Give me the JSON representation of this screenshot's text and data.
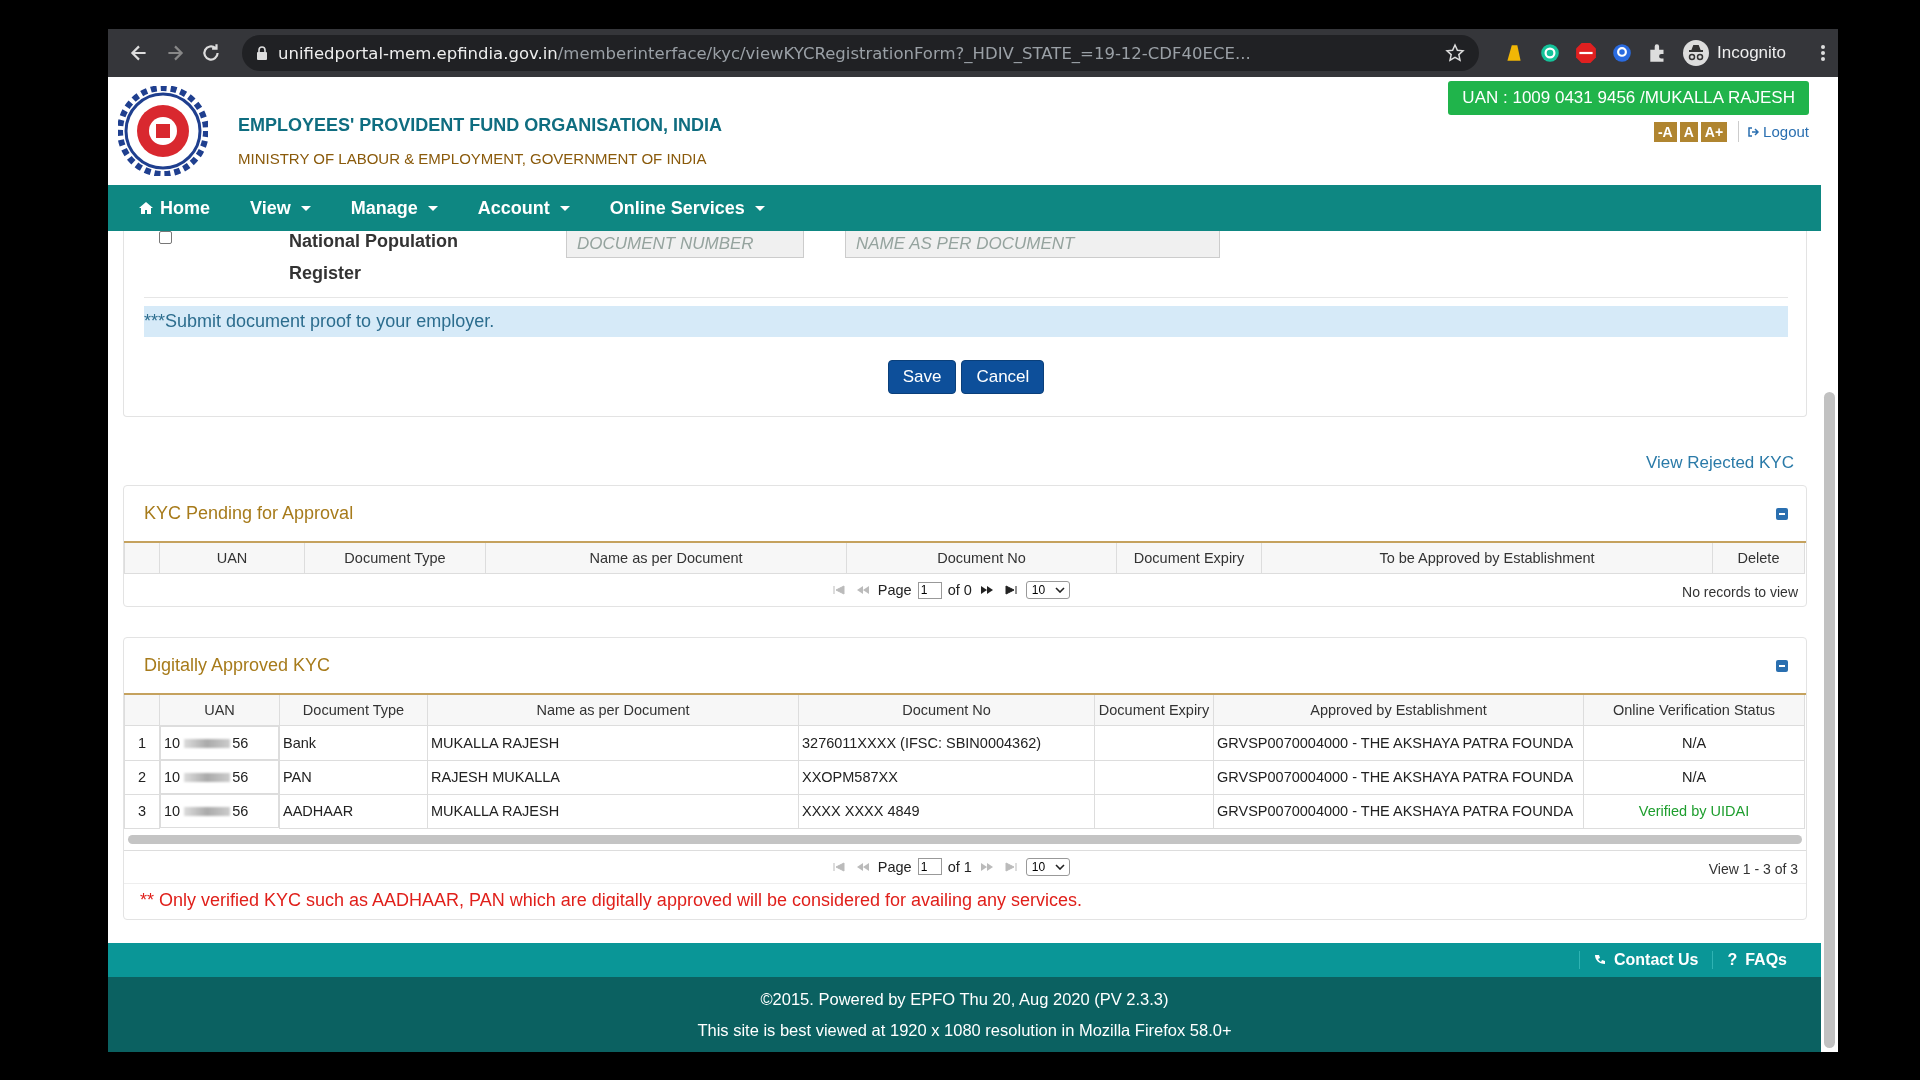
{
  "browser": {
    "url_host": "unifiedportal-mem.epfindia.gov.in",
    "url_path": "/memberinterface/kyc/viewKYCRegistrationForm?_HDIV_STATE_=19-12-CDF40ECE...",
    "profile_label": "Incognito"
  },
  "header": {
    "org_name": "EMPLOYEES' PROVIDENT FUND ORGANISATION, INDIA",
    "ministry": "MINISTRY OF LABOUR & EMPLOYMENT, GOVERNMENT OF INDIA",
    "uan_badge": "UAN : 1009 0431 9456 /MUKALLA RAJESH",
    "font_buttons": [
      "-A",
      "A",
      "A+"
    ],
    "logout": "Logout"
  },
  "nav": [
    {
      "label": "Home",
      "kind": "home"
    },
    {
      "label": "View",
      "kind": "menu"
    },
    {
      "label": "Manage",
      "kind": "menu"
    },
    {
      "label": "Account",
      "kind": "menu"
    },
    {
      "label": "Online Services",
      "kind": "menu"
    }
  ],
  "form": {
    "document": {
      "checked": false,
      "label_lines": [
        "National Population",
        "Register"
      ],
      "number_placeholder": "DOCUMENT NUMBER",
      "name_placeholder": "NAME AS PER DOCUMENT"
    },
    "notice": "***Submit document proof to your employer.",
    "buttons": [
      "Save",
      "Cancel"
    ]
  },
  "view_rejected": "View Rejected KYC",
  "pending": {
    "title": "KYC Pending for Approval",
    "columns": [
      "UAN",
      "Document Type",
      "Name as per Document",
      "Document No",
      "Document Expiry",
      "To be Approved by Establishment",
      "Delete"
    ],
    "pager": {
      "page_label": "Page",
      "page": "1",
      "of": "of 0",
      "size": "10",
      "prev_disabled": true,
      "next_disabled": false,
      "status": "No records to view"
    }
  },
  "approved": {
    "title": "Digitally Approved KYC",
    "columns": [
      "UAN",
      "Document Type",
      "Name as per Document",
      "Document No",
      "Document Expiry",
      "Approved by Establishment",
      "Online Verification Status"
    ],
    "rows": [
      {
        "index": "1",
        "uan_start": "10",
        "uan_end": "56",
        "doc_type": "Bank",
        "name": "MUKALLA RAJESH",
        "doc_no": "3276011XXXX (IFSC: SBIN0004362)",
        "establishment": "GRVSP0070004000 - THE AKSHAYA PATRA FOUNDA",
        "status": "N/A",
        "verified": false
      },
      {
        "index": "2",
        "uan_start": "10",
        "uan_end": "56",
        "doc_type": "PAN",
        "name": "RAJESH MUKALLA",
        "doc_no": "XXOPM587XX",
        "establishment": "GRVSP0070004000 - THE AKSHAYA PATRA FOUNDA",
        "status": "N/A",
        "verified": false
      },
      {
        "index": "3",
        "uan_start": "10",
        "uan_end": "56",
        "doc_type": "AADHAAR",
        "name": "MUKALLA RAJESH",
        "doc_no": "XXXX XXXX 4849",
        "establishment": "GRVSP0070004000 - THE AKSHAYA PATRA FOUNDA",
        "status": "Verified by UIDAI",
        "verified": true
      }
    ],
    "pager": {
      "page_label": "Page",
      "page": "1",
      "of": "of 1",
      "size": "10",
      "prev_disabled": true,
      "next_disabled": true,
      "status": "View 1 - 3 of 3"
    },
    "notice": "** Only verified KYC such as AADHAAR, PAN which are digitally approved will be considered for availing any services."
  },
  "footer": {
    "links": [
      {
        "label": "Contact Us",
        "kind": "phone"
      },
      {
        "label": "FAQs",
        "kind": "help",
        "glyph": "?"
      }
    ],
    "copyright": "©2015. Powered by EPFO Thu 20, Aug 2020 (PV 2.3.3)",
    "best_viewed": "This site is best viewed at 1920 x 1080 resolution in Mozilla Firefox 58.0+"
  }
}
